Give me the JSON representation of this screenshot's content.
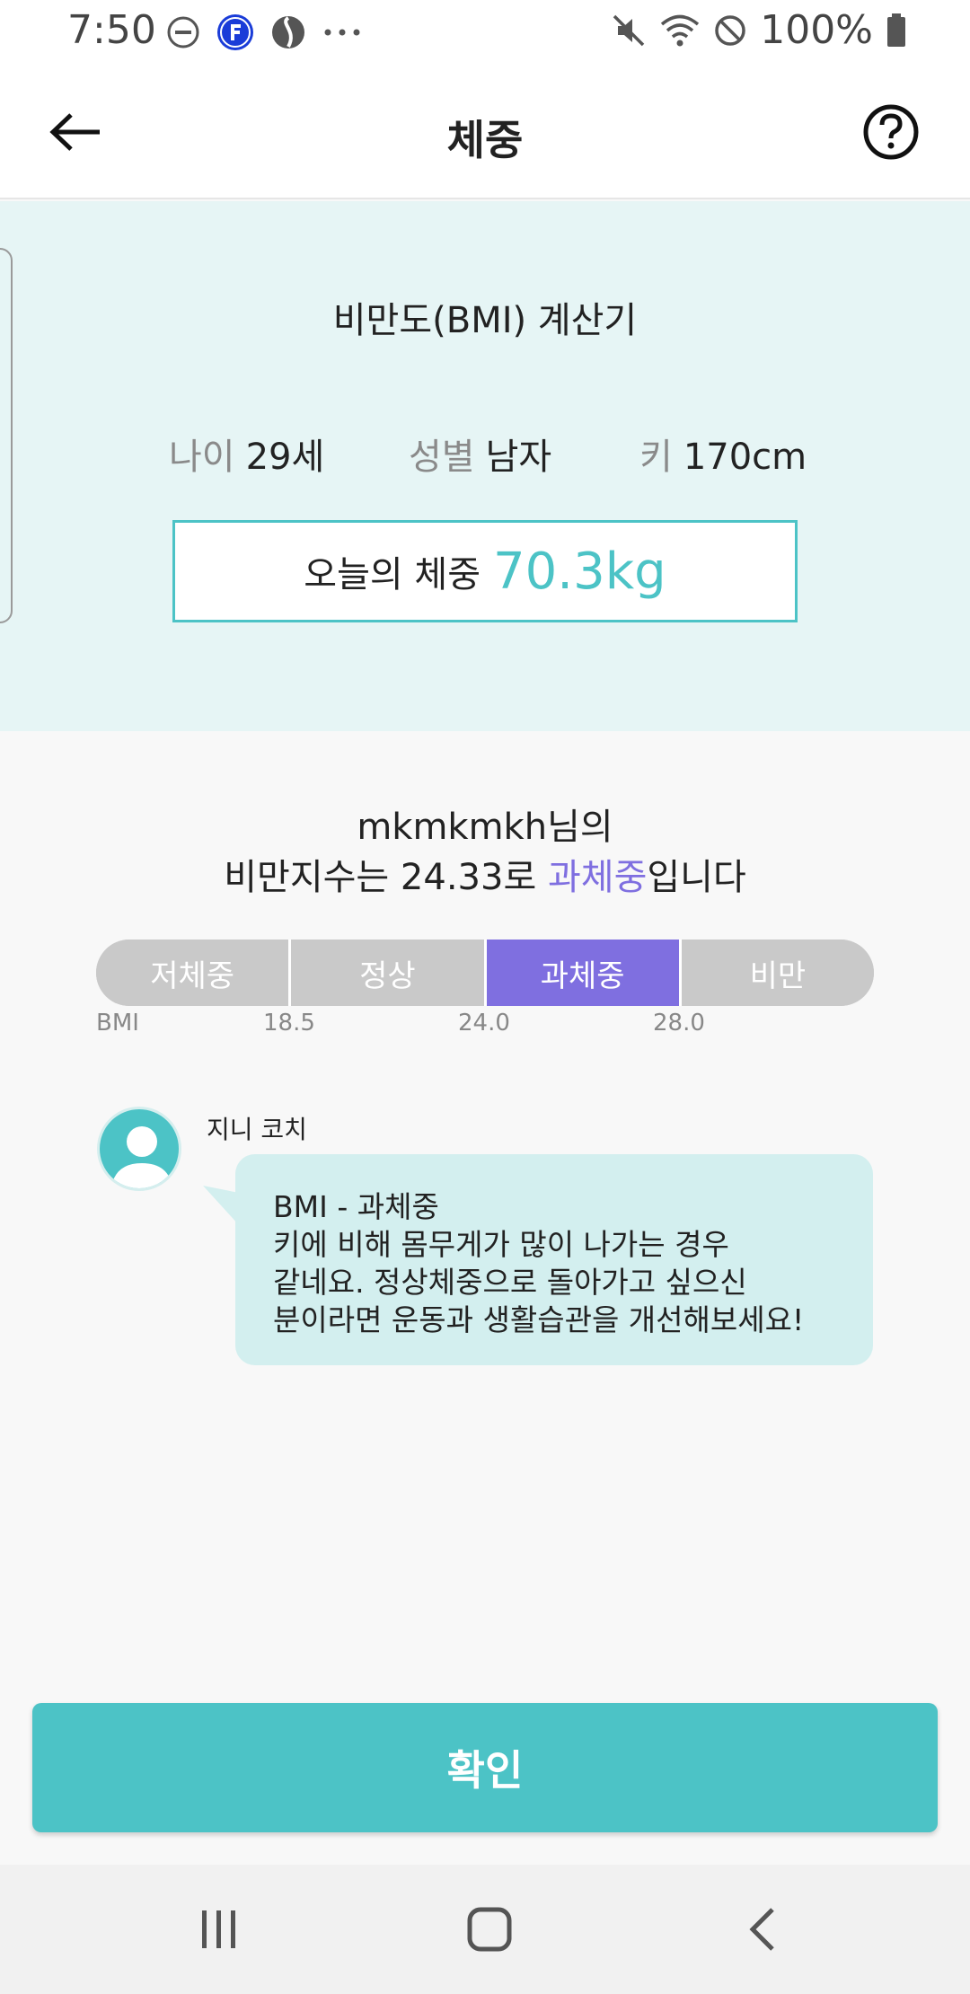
{
  "status_bar": {
    "time": "7:50",
    "battery": "100%",
    "icons_left": [
      "dnd-icon",
      "f-app-icon",
      "s-app-icon",
      "more-dots-icon"
    ],
    "icons_right": [
      "mute-icon",
      "wifi-icon",
      "blocked-icon",
      "battery-icon"
    ]
  },
  "app_bar": {
    "title": "체중",
    "back_icon": "arrow-left-icon",
    "help_icon": "question-circle-icon"
  },
  "info": {
    "calc_title": "비만도(BMI) 계산기",
    "age_label": "나이",
    "age_value": "29세",
    "gender_label": "성별",
    "gender_value": "남자",
    "height_label": "키",
    "height_value": "170cm",
    "weight_label": "오늘의 체중",
    "weight_value": "70.3kg"
  },
  "result": {
    "line1": "mkmkmkh님의",
    "line2_prefix": "비만지수는 24.33로 ",
    "line2_highlight": "과체중",
    "line2_suffix": "입니다"
  },
  "bmi_scale": {
    "segments": [
      "저체중",
      "정상",
      "과체중",
      "비만"
    ],
    "active_index": 2,
    "ticks": [
      "BMI",
      "18.5",
      "24.0",
      "28.0"
    ]
  },
  "coach": {
    "name": "지니 코치",
    "message_lines": [
      "BMI - 과체중",
      "키에 비해 몸무게가 많이 나가는 경우",
      "같네요. 정상체중으로 돌아가고 싶으신",
      "분이라면 운동과 생활습관을 개선해보세요!"
    ]
  },
  "confirm_label": "확인",
  "colors": {
    "accent": "#4cc3c6",
    "highlight": "#7f6fe0",
    "info_bg": "#e6f5f5",
    "bubble_bg": "#d3efef"
  }
}
